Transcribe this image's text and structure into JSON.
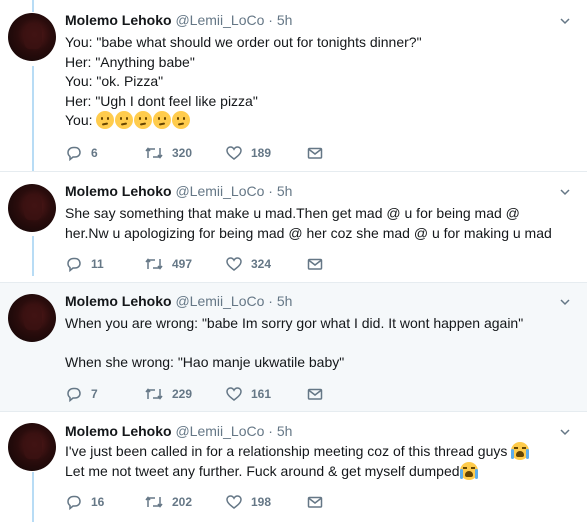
{
  "tweets": [
    {
      "name": "Molemo Lehoko",
      "handle": "@Lemii_LoCo",
      "dot": "·",
      "time": "5h",
      "lines": [
        "You: \"babe what should we order out for tonights dinner?\"",
        "Her: \"Anything babe\"",
        "You: \"ok. Pizza\"",
        "Her: \"Ugh I dont feel like pizza\"",
        "You:"
      ],
      "replies": "6",
      "retweets": "320",
      "likes": "189"
    },
    {
      "name": "Molemo Lehoko",
      "handle": "@Lemii_LoCo",
      "dot": "·",
      "time": "5h",
      "text": "She say something that make u mad.Then get mad @ u for being mad @ her.Nw u apologizing for being mad @ her coz she mad @ u for making u mad",
      "replies": "11",
      "retweets": "497",
      "likes": "324"
    },
    {
      "name": "Molemo Lehoko",
      "handle": "@Lemii_LoCo",
      "dot": "·",
      "time": "5h",
      "lines": [
        "When you are wrong: \"babe Im sorry gor what I did. It wont happen again\"",
        "When she wrong: \"Hao manje ukwatile baby\""
      ],
      "replies": "7",
      "retweets": "229",
      "likes": "161"
    },
    {
      "name": "Molemo Lehoko",
      "handle": "@Lemii_LoCo",
      "dot": "·",
      "time": "5h",
      "lines": [
        "I've just been called in for a relationship meeting coz of this thread guys",
        "Let me not tweet any further. Fuck around & get myself dumped"
      ],
      "replies": "16",
      "retweets": "202",
      "likes": "198"
    }
  ],
  "icons": {
    "reply": "reply-icon",
    "retweet": "retweet-icon",
    "like": "heart-icon",
    "dm": "envelope-icon",
    "more": "chevron-down-icon",
    "confused_emoji": "confused-face-emoji",
    "crying_emoji": "loudly-crying-face-emoji"
  },
  "colors": {
    "thread_line": "#b8dcf5",
    "muted": "#657786",
    "text": "#14171a",
    "highlight_bg": "#f5f8fa",
    "divider": "#e6ecf0"
  }
}
